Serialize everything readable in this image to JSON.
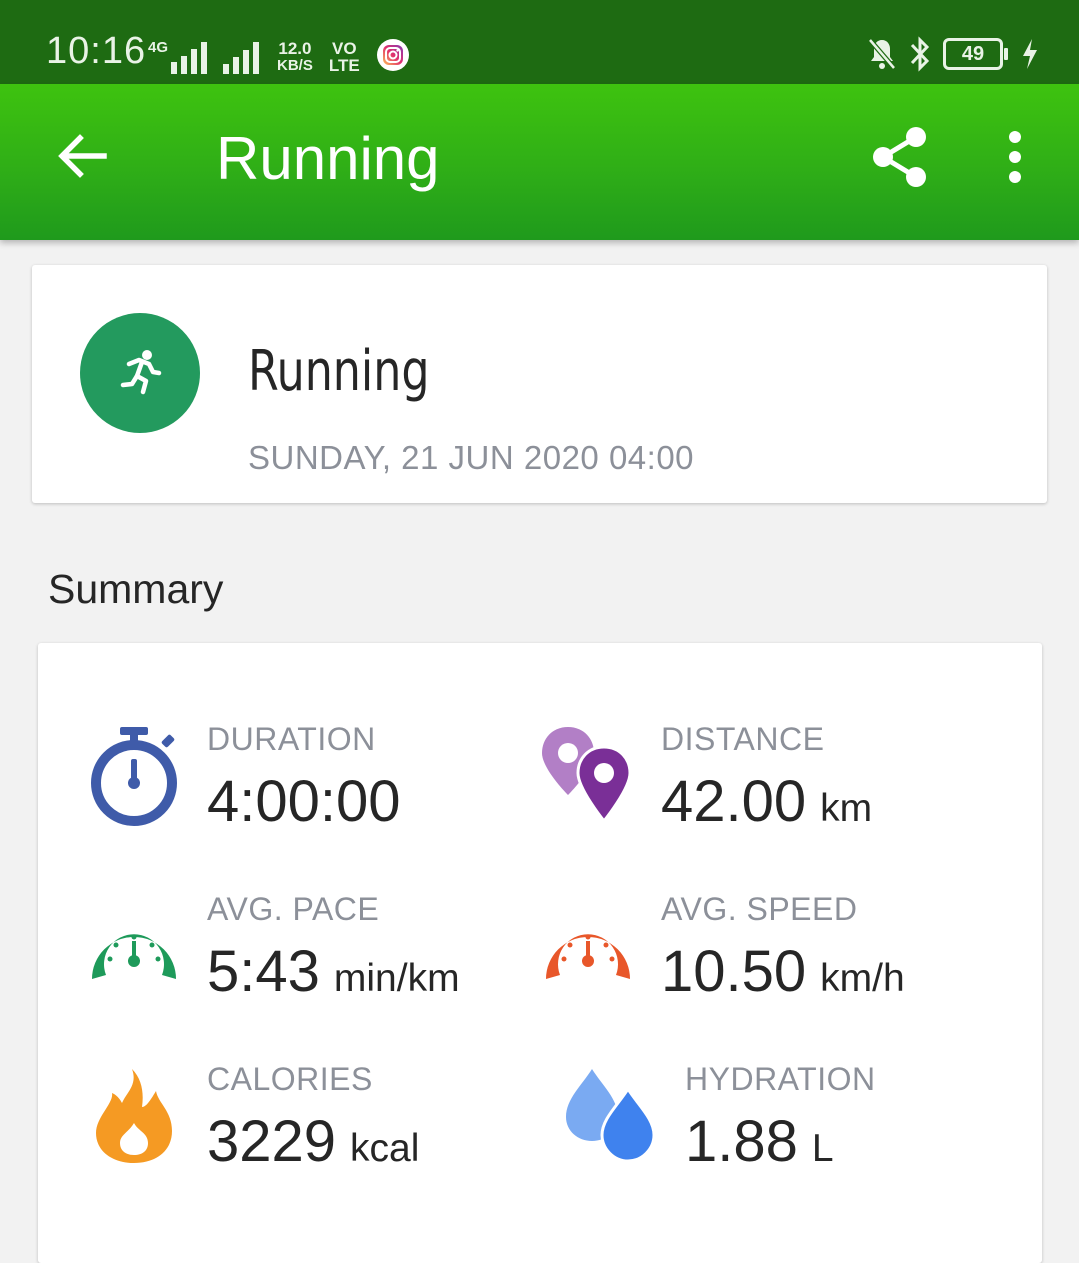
{
  "status_bar": {
    "time": "10:16",
    "network": "4G",
    "speed_value": "12.0",
    "speed_unit": "KB/S",
    "volte_top": "VO",
    "volte_bottom": "LTE",
    "battery": "49"
  },
  "app_bar": {
    "title": "Running",
    "back_icon": "arrow-back-icon",
    "share_icon": "share-icon",
    "more_icon": "more-vert-icon"
  },
  "activity": {
    "name": "Running",
    "date": "SUNDAY, 21 JUN 2020 04:00",
    "icon": "running-icon",
    "icon_color": "#239a5e"
  },
  "summary": {
    "heading": "Summary",
    "stats": {
      "duration": {
        "label": "DURATION",
        "value": "4:00:00",
        "unit": ""
      },
      "distance": {
        "label": "DISTANCE",
        "value": "42.00",
        "unit": "km"
      },
      "avg_pace": {
        "label": "AVG. PACE",
        "value": "5:43",
        "unit": "min/km"
      },
      "avg_speed": {
        "label": "AVG. SPEED",
        "value": "10.50",
        "unit": "km/h"
      },
      "calories": {
        "label": "CALORIES",
        "value": "3229",
        "unit": "kcal"
      },
      "hydration": {
        "label": "HYDRATION",
        "value": "1.88",
        "unit": "L"
      }
    }
  },
  "colors": {
    "status_bar": "#1e6b12",
    "app_bar": "#2fae17",
    "stopwatch": "#3f5ba9",
    "distance_pin_light": "#b27fc6",
    "distance_pin_dark": "#7a2f97",
    "pace_gauge": "#1e9a5a",
    "speed_gauge": "#e8572a",
    "calories_flame": "#f59a23",
    "hydration_drop_light": "#7aaaf2",
    "hydration_drop_dark": "#3f82ee"
  }
}
